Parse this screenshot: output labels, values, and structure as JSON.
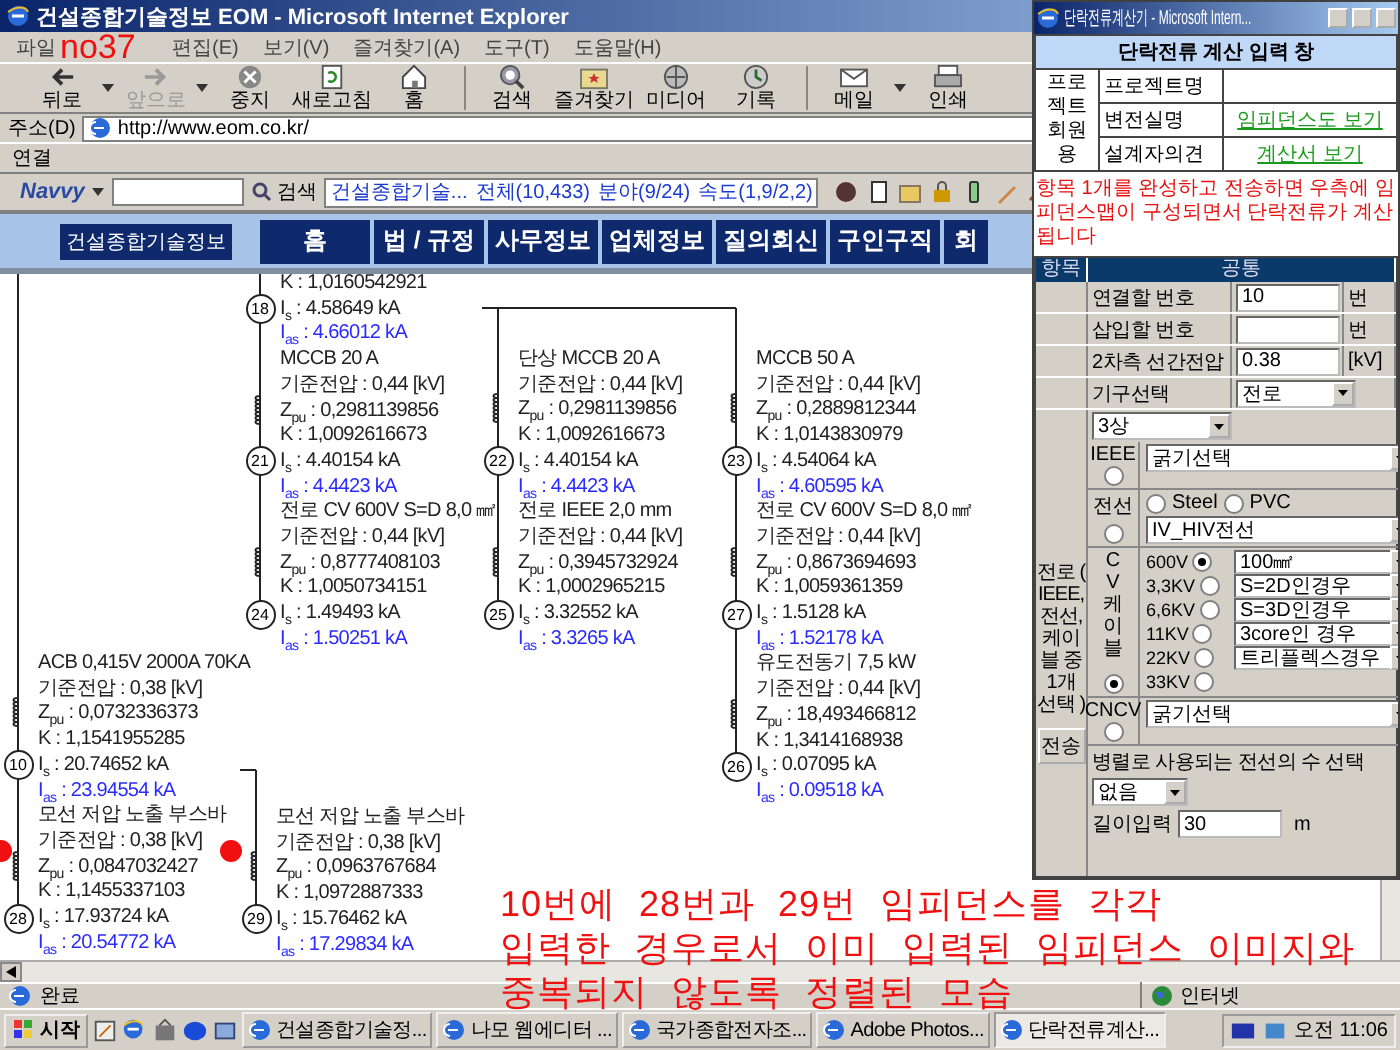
{
  "browser": {
    "title": "건설종합기술정보 EOM - Microsoft Internet Explorer",
    "menu": [
      "파일",
      "편집(E)",
      "보기(V)",
      "즐겨찾기(A)",
      "도구(T)",
      "도움말(H)"
    ],
    "toolbar": [
      {
        "label": "뒤로",
        "disabled": false,
        "dropdown": true
      },
      {
        "label": "앞으로",
        "disabled": true,
        "dropdown": true
      },
      {
        "label": "중지",
        "disabled": false,
        "dropdown": false
      },
      {
        "label": "새로고침",
        "disabled": false,
        "dropdown": false
      },
      {
        "label": "홈",
        "disabled": false,
        "dropdown": false
      },
      {
        "label": "검색",
        "disabled": false,
        "dropdown": false
      },
      {
        "label": "즐겨찾기",
        "disabled": false,
        "dropdown": false
      },
      {
        "label": "미디어",
        "disabled": false,
        "dropdown": false
      },
      {
        "label": "기록",
        "disabled": false,
        "dropdown": false
      },
      {
        "label": "메일",
        "disabled": false,
        "dropdown": true
      },
      {
        "label": "인쇄",
        "disabled": false,
        "dropdown": false
      }
    ],
    "address": {
      "label": "주소(D)",
      "value": "http://www.eom.co.kr/"
    },
    "links_label": "연결",
    "navvy": {
      "brand": "Navvy",
      "search_label": "검색",
      "info": "건설종합기술...",
      "counts": [
        "전체(10,433)",
        "분야(9/24)",
        "속도(1,9/2,2)"
      ]
    }
  },
  "site_nav": {
    "logo": "건설종합기술정보",
    "tabs": [
      "홈",
      "법 / 규정",
      "사무정보",
      "업체정보",
      "질의회신",
      "구인구직",
      "회"
    ]
  },
  "diagram": {
    "columns": [
      {
        "items": [
          {
            "kind": "text",
            "lines": [
              "K : 1,0160542921"
            ]
          },
          {
            "kind": "node",
            "number": "18",
            "is": "I$_{s}$ : 4.58649 kA",
            "ias": "I$_{as}$ : 4.66012 kA"
          },
          {
            "kind": "element",
            "lines": [
              "MCCB 20 A",
              "기준전압 : 0,44 [kV]",
              "Z$_{pu}$ : 0,2981139856",
              "K : 1,0092616673"
            ]
          },
          {
            "kind": "node",
            "number": "21",
            "is": "I$_{s}$ : 4.40154 kA",
            "ias": "I$_{as}$ : 4.4423 kA"
          },
          {
            "kind": "element",
            "lines": [
              "전로 CV 600V S=D 8,0 ㎟",
              "기준전압 : 0,44 [kV]",
              "Z$_{pu}$ : 0,8777408103",
              "K : 1,0050734151"
            ]
          },
          {
            "kind": "node",
            "number": "24",
            "is": "I$_{s}$ : 1.49493 kA",
            "ias": "I$_{as}$ : 1.50251 kA"
          }
        ]
      },
      {
        "items": [
          {
            "kind": "element",
            "lines": [
              "단상 MCCB 20 A",
              "기준전압 : 0,44 [kV]",
              "Z$_{pu}$ : 0,2981139856",
              "K : 1,0092616673"
            ]
          },
          {
            "kind": "node",
            "number": "22",
            "is": "I$_{s}$ : 4.40154 kA",
            "ias": "I$_{as}$ : 4.4423 kA"
          },
          {
            "kind": "element",
            "lines": [
              "전로 IEEE 2,0 mm",
              "기준전압 : 0,44 [kV]",
              "Z$_{pu}$ : 0,3945732924",
              "K : 1,0002965215"
            ]
          },
          {
            "kind": "node",
            "number": "25",
            "is": "I$_{s}$ : 3.32552 kA",
            "ias": "I$_{as}$ : 3.3265 kA"
          }
        ]
      },
      {
        "items": [
          {
            "kind": "element",
            "lines": [
              "MCCB 50 A",
              "기준전압 : 0,44 [kV]",
              "Z$_{pu}$ : 0,2889812344",
              "K : 1,0143830979"
            ]
          },
          {
            "kind": "node",
            "number": "23",
            "is": "I$_{s}$ : 4.54064 kA",
            "ias": "I$_{as}$ : 4.60595 kA"
          },
          {
            "kind": "element",
            "lines": [
              "전로 CV 600V S=D 8,0 ㎟",
              "기준전압 : 0,44 [kV]",
              "Z$_{pu}$ : 0,8673694693",
              "K : 1,0059361359"
            ]
          },
          {
            "kind": "node",
            "number": "27",
            "is": "I$_{s}$ : 1.5128 kA",
            "ias": "I$_{as}$ : 1.52178 kA"
          },
          {
            "kind": "element",
            "lines": [
              "유도전동기 7,5 kW",
              "기준전압 : 0,44 [kV]",
              "Z$_{pu}$ : 18,493466812",
              "K : 1,3414168938"
            ]
          },
          {
            "kind": "node",
            "number": "26",
            "is": "I$_{s}$ : 0.07095 kA",
            "ias": "I$_{as}$ : 0.09518 kA"
          }
        ]
      },
      {
        "items": [
          {
            "kind": "element",
            "lines": [
              "ACB 0,415V 2000A 70KA",
              "기준전압 : 0,38 [kV]",
              "Z$_{pu}$ : 0,0732336373",
              "K : 1,1541955285"
            ]
          },
          {
            "kind": "node",
            "number": "10",
            "is": "I$_{s}$ : 20.74652 kA",
            "ias": "I$_{as}$ : 23.94554 kA"
          },
          {
            "kind": "element",
            "lines": [
              "모선 저압 노출 부스바",
              "기준전압 : 0,38 [kV]",
              "Z$_{pu}$ : 0,0847032427",
              "K : 1,1455337103"
            ]
          },
          {
            "kind": "node",
            "number": "28",
            "is": "I$_{s}$ : 17.93724 kA",
            "ias": "I$_{as}$ : 20.54772 kA"
          }
        ]
      },
      {
        "items": [
          {
            "kind": "element",
            "lines": [
              "모선 저압 노출 부스바",
              "기준전압 : 0,38 [kV]",
              "Z$_{pu}$ : 0,0963767684",
              "K : 1,0972887333"
            ]
          },
          {
            "kind": "node",
            "number": "29",
            "is": "I$_{s}$ : 15.76462 kA",
            "ias": "I$_{as}$ : 17.29834 kA"
          }
        ]
      }
    ]
  },
  "status": {
    "text": "완료",
    "zone": "인터넷"
  },
  "taskbar": {
    "start": "시작",
    "tasks": [
      {
        "label": "건설종합기술정...",
        "selected": false
      },
      {
        "label": "나모 웹에디터 ...",
        "selected": false
      },
      {
        "label": "국가종합전자조...",
        "selected": false
      },
      {
        "label": "Adobe Photos...",
        "selected": false
      },
      {
        "label": "단락전류계산...",
        "selected": true
      }
    ],
    "clock": "오전 11:06"
  },
  "popup": {
    "title": "단락전류계산기 - Microsoft Intern...",
    "heading": "단락전류 계산 입력 창",
    "project": {
      "label": "프로젝트회원용",
      "rows": [
        {
          "label": "프로젝트명"
        },
        {
          "label": "변전실명",
          "link": "임피던스도 보기"
        },
        {
          "label": "설계자의견",
          "link": "계산서 보기"
        }
      ]
    },
    "notice": "항목 1개를 완성하고 전송하면 우측에 임피던스맵이 구성되면서 단락전류가 계산됩니다",
    "form": {
      "header": [
        "항목",
        "공통"
      ],
      "fields": [
        {
          "kind": "input",
          "label": "연결할 번호",
          "value": "10",
          "unit": "번"
        },
        {
          "kind": "input",
          "label": "삽입할 번호",
          "unit": "번"
        },
        {
          "kind": "input",
          "label": "2차측 선간전압",
          "value": "0.38",
          "unit": "[kV]"
        },
        {
          "kind": "select",
          "label": "기구선택",
          "value": "전로"
        }
      ],
      "section": {
        "label": "전로 ( IEEE, 전선, 케이블 중 1개 선택 )",
        "submit": "전송",
        "phase": "3상",
        "ieee": {
          "label": "IEEE",
          "selected": false,
          "size": "굵기선택"
        },
        "wire": {
          "label": "전선",
          "selected": false,
          "options": [
            {
              "label": "Steel",
              "selected": false
            },
            {
              "label": "PVC",
              "selected": false
            }
          ],
          "type": "IV_HIV전선"
        },
        "cv": {
          "label": "CV케이블",
          "selected": true,
          "voltages": [
            {
              "label": "600V",
              "selected": true
            },
            {
              "label": "3,3KV",
              "selected": false
            },
            {
              "label": "6,6KV",
              "selected": false
            },
            {
              "label": "11KV",
              "selected": false
            },
            {
              "label": "22KV",
              "selected": false
            },
            {
              "label": "33KV",
              "selected": false
            }
          ],
          "options": [
            "100㎟",
            "S=2D인경우",
            "S=3D인경우",
            "3core인 경우",
            "트리플렉스경우"
          ]
        },
        "cncv": {
          "label": "CNCV",
          "selected": false,
          "size": "굵기선택"
        },
        "parallel": {
          "label": "병렬로 사용되는 전선의 수 선택",
          "value": "없음"
        },
        "length": {
          "label": "길이입력",
          "value": "30",
          "unit": "m"
        }
      }
    }
  },
  "annotations": {
    "tag": "no37",
    "caption": [
      "10번에 28번과 29번 임피던스를 각각",
      "입력한 경우로서 이미 입력된 임피던스 이미지와",
      "중복되지 않도록 정렬된 모습"
    ]
  }
}
